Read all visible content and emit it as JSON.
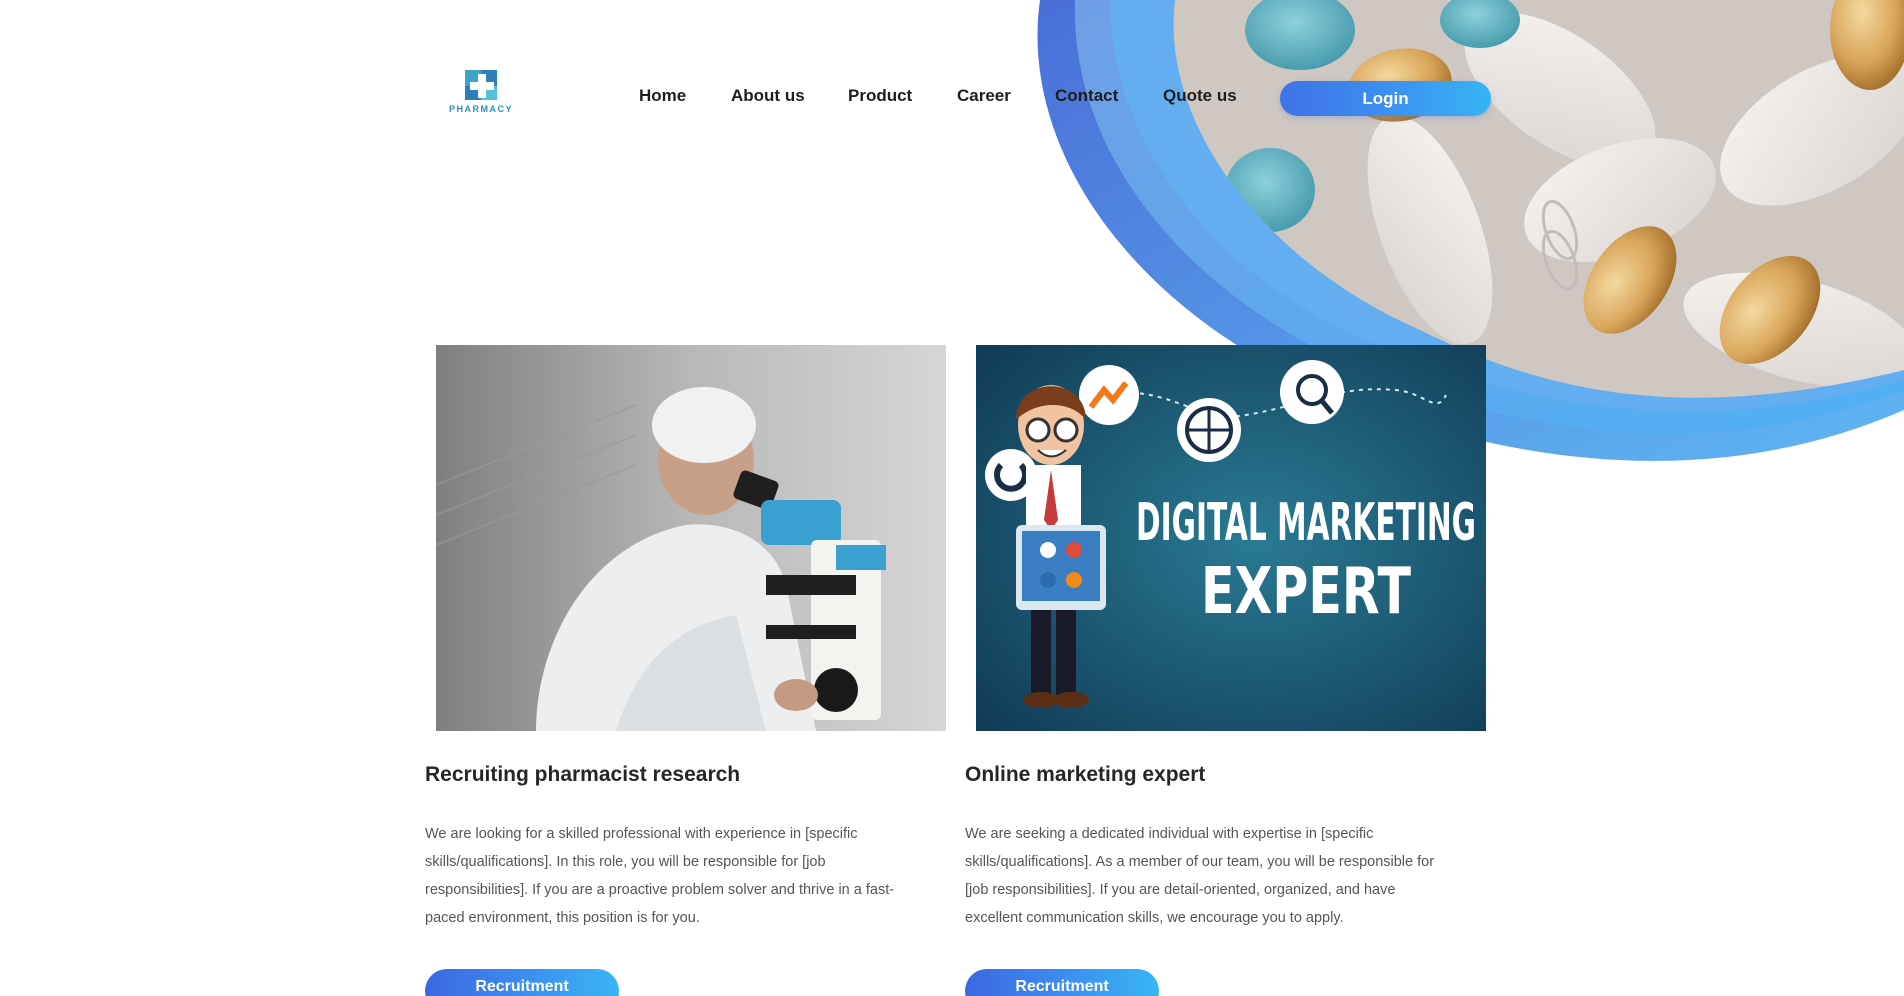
{
  "brand": {
    "logo_text": "PHARMACY",
    "primary_color": "#3c8cf0",
    "accent_light": "#38b6f4"
  },
  "nav": {
    "items": [
      "Home",
      "About us",
      "Product",
      "Career",
      "Contact",
      "Quote us"
    ],
    "login_label": "Login"
  },
  "jobs": [
    {
      "title": "Recruiting pharmacist research",
      "description": "We are looking for a skilled professional with experience in [specific skills/qualifications]. In this role, you will be responsible for [job responsibilities]. If you are a proactive problem solver and thrive in a fast-paced environment, this position is for you.",
      "button_label": "Recruitment",
      "image": "scientist-microscope-photo"
    },
    {
      "title": "Online marketing expert",
      "description": "We are seeking a dedicated individual with expertise in [specific skills/qualifications]. As a member of our team, you will be responsible for [job responsibilities]. If you are detail-oriented, organized, and have excellent communication skills, we encourage you to apply.",
      "button_label": "Recruitment",
      "image": "digital-marketing-expert-banner",
      "image_text": {
        "line1": "DIGITAL MARKETING",
        "line2": "EXPERT"
      }
    }
  ]
}
